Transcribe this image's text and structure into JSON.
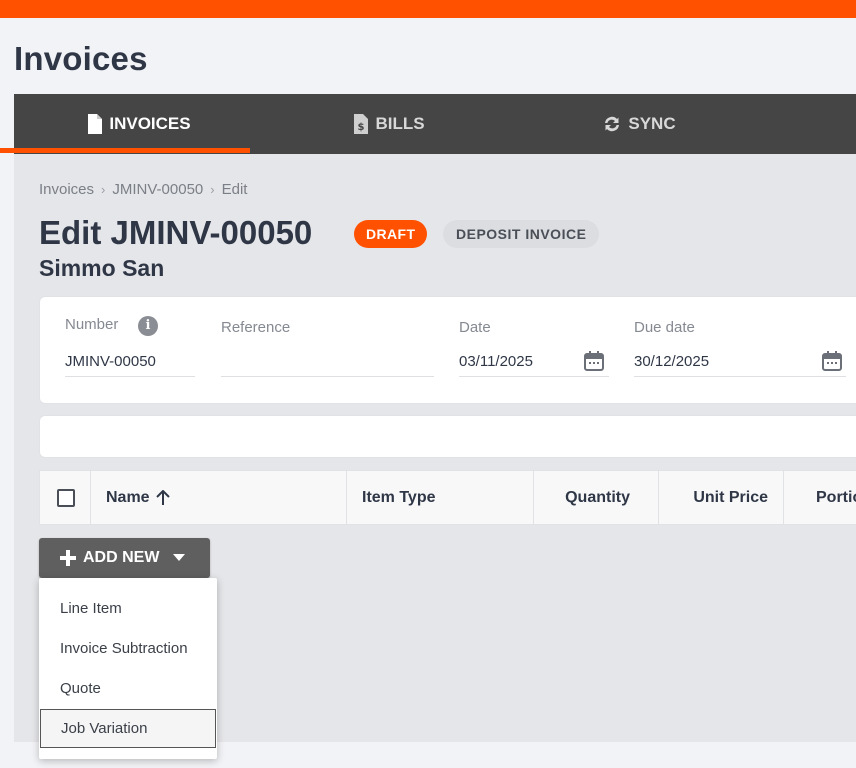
{
  "page": {
    "title": "Invoices"
  },
  "tabs": [
    {
      "label": "INVOICES",
      "icon": "file-icon",
      "active": true
    },
    {
      "label": "BILLS",
      "icon": "bill-icon",
      "active": false
    },
    {
      "label": "SYNC",
      "icon": "sync-icon",
      "active": false
    }
  ],
  "breadcrumb": [
    "Invoices",
    "JMINV-00050",
    "Edit"
  ],
  "header": {
    "title": "Edit JMINV-00050",
    "status_badge": "DRAFT",
    "type_badge": "DEPOSIT INVOICE",
    "customer": "Simmo San"
  },
  "form": {
    "number": {
      "label": "Number",
      "value": "JMINV-00050"
    },
    "reference": {
      "label": "Reference",
      "value": ""
    },
    "date": {
      "label": "Date",
      "value": "03/11/2025"
    },
    "due_date": {
      "label": "Due date",
      "value": "30/12/2025"
    }
  },
  "table": {
    "columns": [
      "Name",
      "Item Type",
      "Quantity",
      "Unit Price",
      "Portio"
    ]
  },
  "add_new": {
    "label": "ADD NEW",
    "menu": [
      "Line Item",
      "Invoice Subtraction",
      "Quote",
      "Job Variation"
    ]
  },
  "colors": {
    "accent": "#ff5100",
    "tab_bar": "#454545",
    "button": "#5f5f5f"
  }
}
